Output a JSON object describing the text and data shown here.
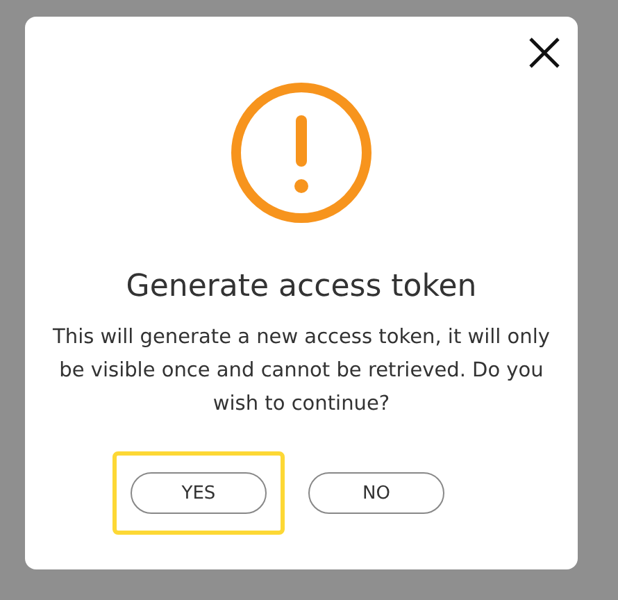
{
  "dialog": {
    "title": "Generate access token",
    "message": "This will generate a new access token, it will only be visible once and cannot be retrieved. Do you wish to continue?",
    "buttons": [
      {
        "label": "YES",
        "focused": true
      },
      {
        "label": "NO",
        "focused": false
      }
    ]
  }
}
